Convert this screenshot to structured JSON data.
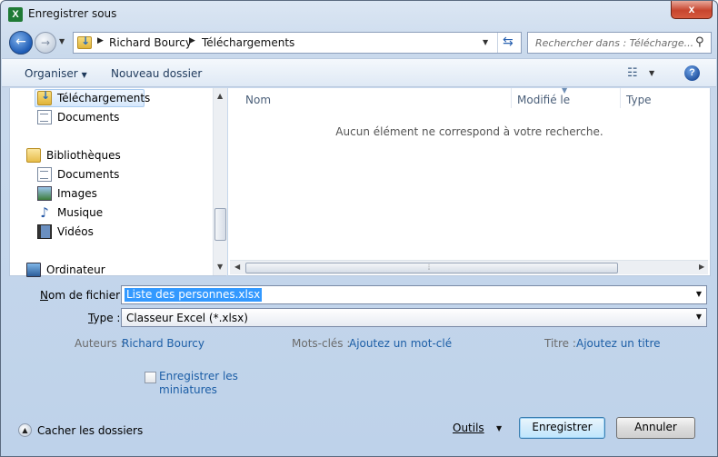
{
  "window": {
    "title": "Enregistrer sous",
    "close_glyph": "x"
  },
  "address": {
    "crumbs": [
      "Richard Bourcy",
      "Téléchargements"
    ],
    "search_placeholder": "Rechercher dans : Télécharge..."
  },
  "toolbar": {
    "organize": "Organiser",
    "new_folder": "Nouveau dossier",
    "help": "?"
  },
  "nav": {
    "items": [
      {
        "label": "Téléchargements",
        "icon": "downloads-folder-icon",
        "selected": true
      },
      {
        "label": "Documents",
        "icon": "document-icon"
      },
      {
        "label": "Bibliothèques",
        "icon": "libraries-icon"
      },
      {
        "label": "Documents",
        "icon": "document-icon"
      },
      {
        "label": "Images",
        "icon": "images-icon"
      },
      {
        "label": "Musique",
        "icon": "music-icon"
      },
      {
        "label": "Vidéos",
        "icon": "videos-icon"
      },
      {
        "label": "Ordinateur",
        "icon": "computer-icon"
      }
    ]
  },
  "filelist": {
    "columns": [
      "Nom",
      "Modifié le",
      "Type"
    ],
    "empty_message": "Aucun élément ne correspond à votre recherche."
  },
  "form": {
    "filename_label_prefix": "N",
    "filename_label_rest": "om de fichier :",
    "filename_value": "Liste des personnes.xlsx",
    "type_label_prefix": "T",
    "type_label_rest": "ype :",
    "type_value": "Classeur Excel (*.xlsx)",
    "authors_label": "Auteurs :",
    "authors_value": "Richard Bourcy",
    "tags_label": "Mots-clés :",
    "tags_value": "Ajoutez un mot-clé",
    "title_label": "Titre :",
    "title_value": "Ajoutez un titre",
    "thumbnail_line1": "Enregistrer les",
    "thumbnail_line2": "miniatures",
    "thumbnail_checked": false
  },
  "footer": {
    "hide_folders": "Cacher les dossiers",
    "tools": "Outils",
    "save": "Enregistrer",
    "cancel": "Annuler"
  }
}
